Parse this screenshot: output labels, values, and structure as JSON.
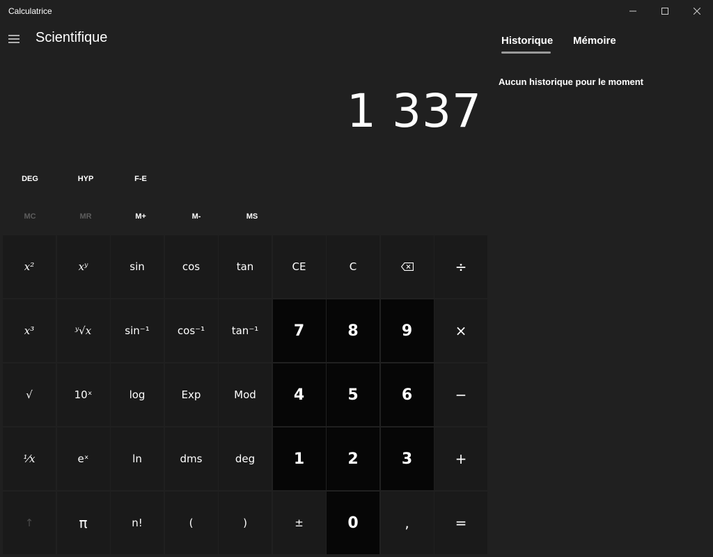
{
  "app": {
    "title": "Calculatrice"
  },
  "header": {
    "mode": "Scientifique"
  },
  "display": {
    "value": "1 337"
  },
  "modes": {
    "deg": "DEG",
    "hyp": "HYP",
    "fe": "F-E"
  },
  "memory": {
    "mc": "MC",
    "mr": "MR",
    "m_plus": "M+",
    "m_minus": "M-",
    "ms": "MS"
  },
  "keys": {
    "x2": "x²",
    "xy": "xʸ",
    "sin": "sin",
    "cos": "cos",
    "tan": "tan",
    "ce": "CE",
    "c": "C",
    "divide": "÷",
    "x3": "x³",
    "yroot": "ʸ√x",
    "asin": "sin⁻¹",
    "acos": "cos⁻¹",
    "atan": "tan⁻¹",
    "seven": "7",
    "eight": "8",
    "nine": "9",
    "multiply": "×",
    "sqrt": "√",
    "tenx": "10ˣ",
    "log": "log",
    "exp": "Exp",
    "mod": "Mod",
    "four": "4",
    "five": "5",
    "six": "6",
    "minus": "−",
    "recip": "¹⁄x",
    "ex": "eˣ",
    "ln": "ln",
    "dms": "dms",
    "deg": "deg",
    "one": "1",
    "two": "2",
    "three": "3",
    "plus": "+",
    "shift": "↑",
    "pi": "π",
    "fact": "n!",
    "lparen": "(",
    "rparen": ")",
    "negate": "±",
    "zero": "0",
    "decimal": ",",
    "equals": "="
  },
  "history": {
    "tab_history": "Historique",
    "tab_memory": "Mémoire",
    "empty": "Aucun historique pour le moment"
  },
  "icons": {
    "hamburger": "hamburger-icon",
    "backspace": "backspace-icon",
    "minimize": "minimize-icon",
    "maximize": "maximize-icon",
    "close": "close-icon"
  },
  "colors": {
    "background": "#202020",
    "key_function": "#1a1a1a",
    "key_number": "#060606",
    "disabled_text": "#5d5d5d"
  }
}
